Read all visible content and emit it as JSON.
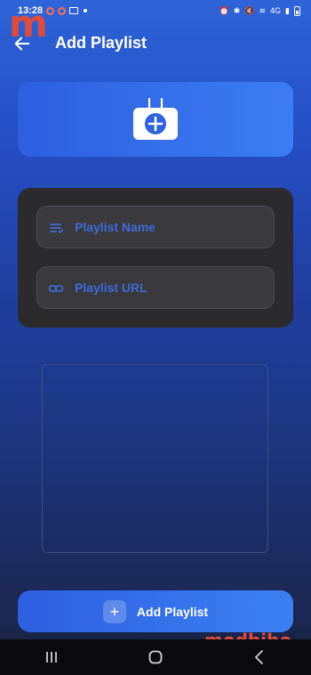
{
  "status": {
    "time": "13:28",
    "network": "4G"
  },
  "watermark": {
    "top_left": "m",
    "bottom_right": "modbibo"
  },
  "appbar": {
    "title": "Add Playlist"
  },
  "form": {
    "name_placeholder": "Playlist Name",
    "url_placeholder": "Playlist URL"
  },
  "actions": {
    "add_label": "Add Playlist",
    "add_symbol": "+"
  },
  "colors": {
    "accent": "#3b7df2",
    "card_bg": "#2b2b2e",
    "field_bg": "#3a3a3e",
    "placeholder": "#3f6ad8",
    "watermark": "#e04b3c"
  },
  "icons": {
    "back": "arrow-left-icon",
    "playlist_image": "tv-add-icon",
    "name_field": "list-icon",
    "url_field": "link-icon",
    "add": "plus-icon"
  }
}
